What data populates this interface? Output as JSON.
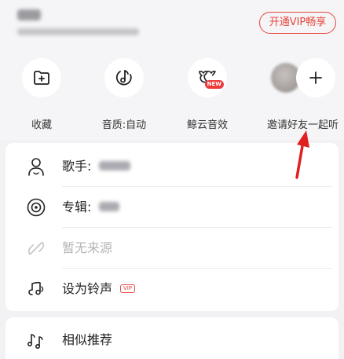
{
  "header": {
    "vip_button": "开通VIP畅享"
  },
  "actions": [
    {
      "label": "收藏",
      "icon": "collect-icon"
    },
    {
      "label": "音质:自动",
      "icon": "sound-quality-icon"
    },
    {
      "label": "鲸云音效",
      "icon": "whale-sound-effect-icon",
      "badge": "NEW"
    },
    {
      "label": "邀请好友一起听",
      "icon": "plus-icon"
    }
  ],
  "menu": {
    "singer_label": "歌手:",
    "album_label": "专辑:",
    "source_label": "暂无来源",
    "ringtone_label": "设为铃声",
    "ringtone_tag": "VIP"
  },
  "menu2": {
    "similar_label": "相似推荐"
  },
  "colors": {
    "accent": "#e8473c",
    "background": "#f2f2f4",
    "card": "#ffffff",
    "annotation_arrow": "#e02020"
  }
}
